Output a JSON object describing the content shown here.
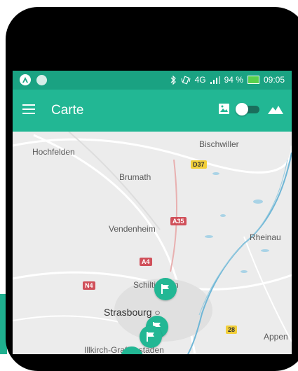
{
  "status_bar": {
    "bluetooth_icon": "bluetooth-icon",
    "vibrate_icon": "vibrate-icon",
    "network": "4G",
    "battery_percent": "94 %",
    "time": "09:05"
  },
  "app_bar": {
    "title": "Carte",
    "menu_icon": "hamburger-menu-icon",
    "image_icon": "image-icon",
    "terrain_icon": "mountain-icon",
    "toggle_state": "on"
  },
  "map": {
    "labels": {
      "hochfelden": "Hochfelden",
      "bischwiller": "Bischwiller",
      "brumath": "Brumath",
      "vendenheim": "Vendenheim",
      "rheinau": "Rheinau",
      "schiltigheim": "Schiltigheim",
      "strasbourg": "Strasbourg",
      "appenweier": "Appen",
      "illkirch": "Illkirch-Graffenstaden"
    },
    "road_shields": {
      "d37": "D37",
      "a35": "A35",
      "a4": "A4",
      "n4": "N4",
      "r28": "28"
    },
    "marker_icon": "flag-icon"
  },
  "colors": {
    "status_bar": "#1aa282",
    "app_bar": "#22b794",
    "map_bg": "#ececec",
    "river": "#6fb6d6",
    "marker": "#22b794"
  }
}
